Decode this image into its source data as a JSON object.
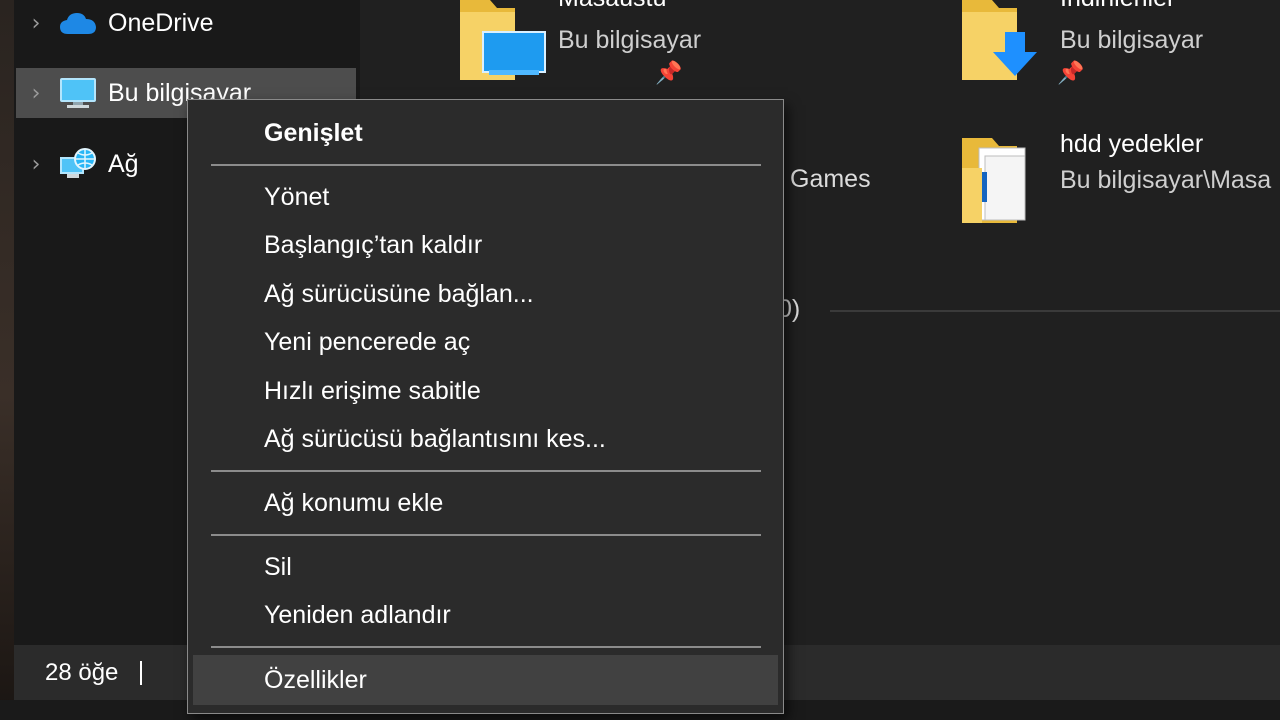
{
  "navigation": {
    "items": [
      {
        "label": "OneDrive",
        "icon": "onedrive-cloud-icon"
      },
      {
        "label": "Bu bilgisayar",
        "icon": "this-pc-monitor-icon"
      },
      {
        "label": "Ağ",
        "icon": "network-globe-icon"
      }
    ]
  },
  "content": {
    "tiles": [
      {
        "name": "Masaüstü",
        "location": "Bu bilgisayar",
        "icon": "desktop-folder-icon"
      },
      {
        "name": "İndirilenler",
        "location": "Bu bilgisayar",
        "icon": "downloads-folder-icon"
      },
      {
        "name": "hdd yedekler",
        "location": "Bu bilgisayar\\Masa",
        "icon": "document-folder-icon"
      }
    ],
    "partial_games_text": "Games",
    "partial_section_count": "0)"
  },
  "status_bar": {
    "item_count": "28 öğe"
  },
  "context_menu": {
    "groups": [
      [
        "Genişlet"
      ],
      [
        "Yönet",
        "Başlangıç’tan kaldır",
        "Ağ sürücüsüne bağlan...",
        "Yeni pencerede aç",
        "Hızlı erişime sabitle",
        "Ağ sürücüsü bağlantısını kes..."
      ],
      [
        "Ağ konumu ekle"
      ],
      [
        "Sil",
        "Yeniden adlandır"
      ],
      [
        "Özellikler"
      ]
    ],
    "items": {
      "expand": "Genişlet",
      "manage": "Yönet",
      "unpin_start": "Başlangıç’tan kaldır",
      "map_drive": "Ağ sürücüsüne bağlan...",
      "open_new_window": "Yeni pencerede aç",
      "pin_quick_access": "Hızlı erişime sabitle",
      "disconnect_drive": "Ağ sürücüsü bağlantısını kes...",
      "add_network_location": "Ağ konumu ekle",
      "delete": "Sil",
      "rename": "Yeniden adlandır",
      "properties": "Özellikler"
    }
  },
  "colors": {
    "nav_background": "#191919",
    "content_background": "#202020",
    "selected_background": "#4d4d4d",
    "menu_background": "#2b2b2b",
    "menu_hover": "#414141",
    "folder_yellow": "#f0c24a",
    "accent_blue": "#1e90ff"
  }
}
